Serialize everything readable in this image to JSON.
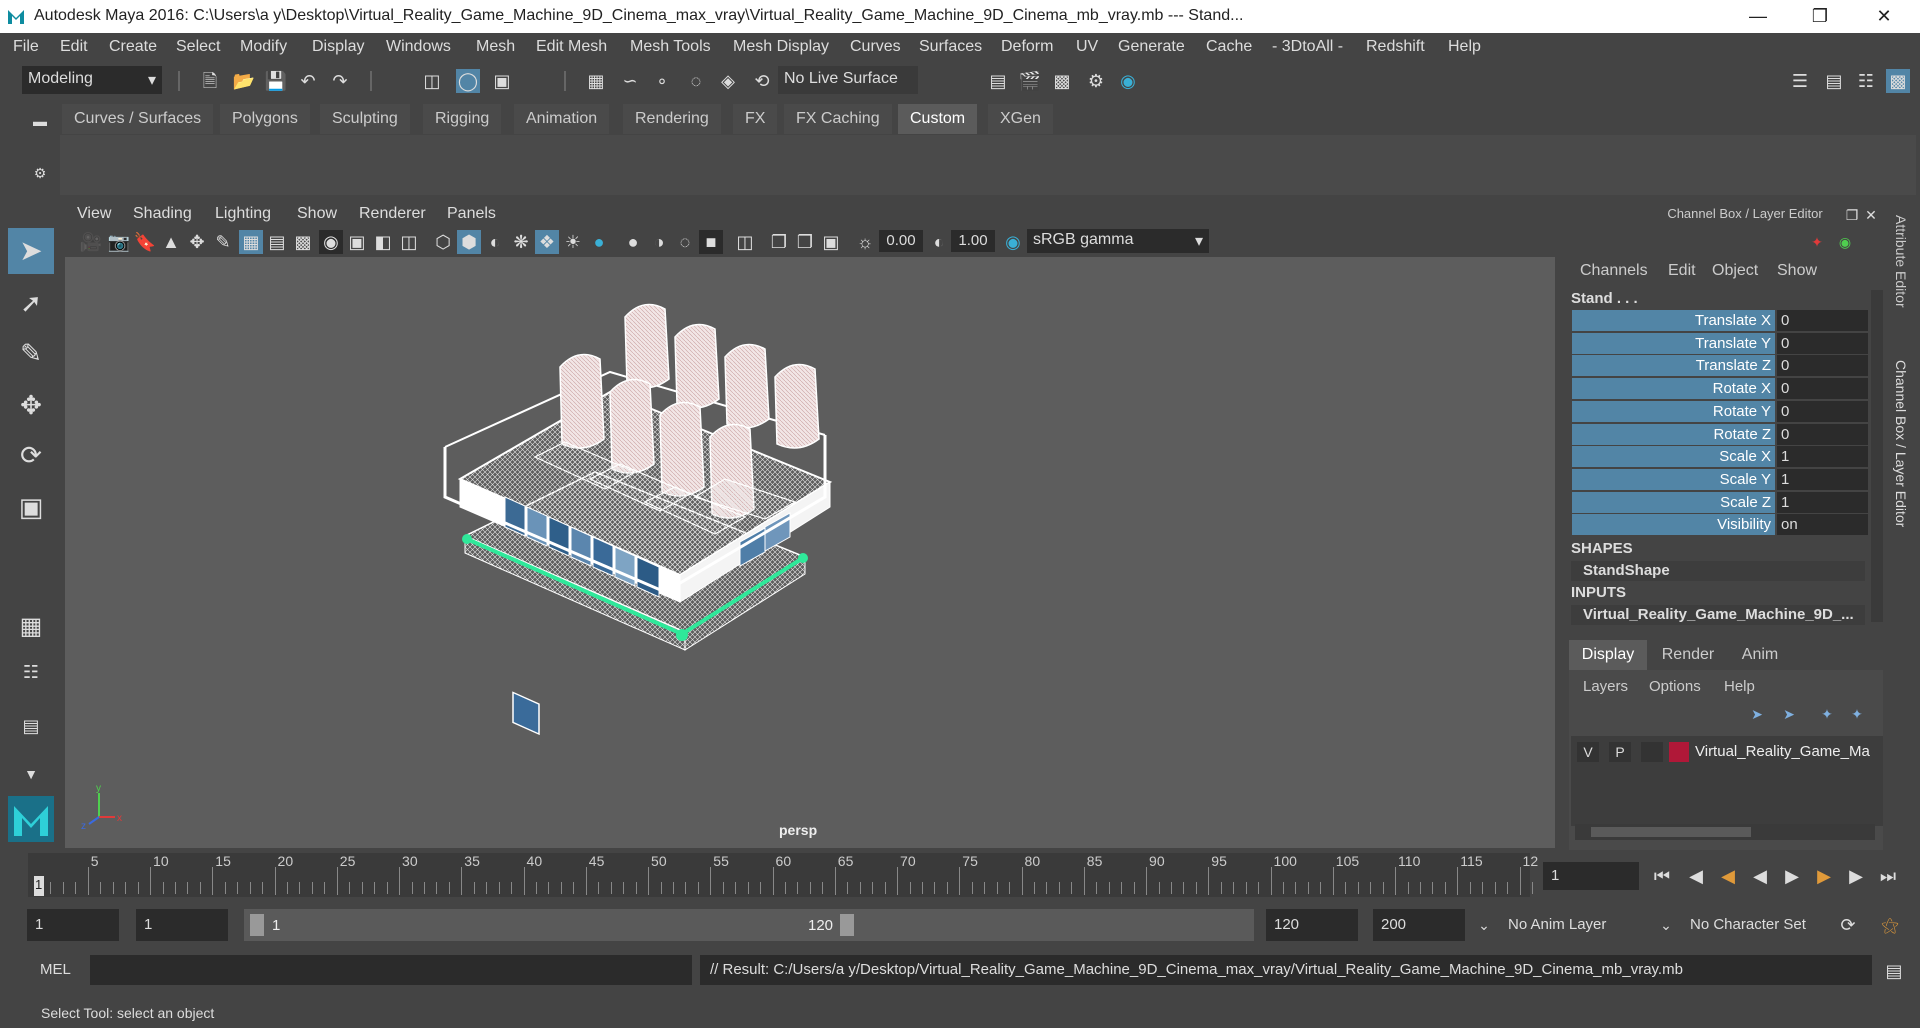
{
  "window": {
    "title": "Autodesk Maya 2016: C:\\Users\\a y\\Desktop\\Virtual_Reality_Game_Machine_9D_Cinema_max_vray\\Virtual_Reality_Game_Machine_9D_Cinema_mb_vray.mb  ---  Stand..."
  },
  "menubar": [
    "File",
    "Edit",
    "Create",
    "Select",
    "Modify",
    "Display",
    "Windows",
    "Mesh",
    "Edit Mesh",
    "Mesh Tools",
    "Mesh Display",
    "Curves",
    "Surfaces",
    "Deform",
    "UV",
    "Generate",
    "Cache",
    "- 3DtoAll -",
    "Redshift",
    "Help"
  ],
  "statusline": {
    "mode": "Modeling",
    "live_surface": "No Live Surface"
  },
  "shelf": {
    "tabs": [
      "Curves / Surfaces",
      "Polygons",
      "Sculpting",
      "Rigging",
      "Animation",
      "Rendering",
      "FX",
      "FX Caching",
      "Custom",
      "XGen"
    ],
    "active_tab": "Custom"
  },
  "viewport": {
    "menu": [
      "View",
      "Shading",
      "Lighting",
      "Show",
      "Renderer",
      "Panels"
    ],
    "exposure": "0.00",
    "gamma": "1.00",
    "color_space": "sRGB gamma",
    "camera_label": "persp"
  },
  "channel_box": {
    "title": "Channel Box / Layer Editor",
    "menu": [
      "Channels",
      "Edit",
      "Object",
      "Show"
    ],
    "object_name": "Stand . . .",
    "attributes": [
      {
        "label": "Translate X",
        "value": "0"
      },
      {
        "label": "Translate Y",
        "value": "0"
      },
      {
        "label": "Translate Z",
        "value": "0"
      },
      {
        "label": "Rotate X",
        "value": "0"
      },
      {
        "label": "Rotate Y",
        "value": "0"
      },
      {
        "label": "Rotate Z",
        "value": "0"
      },
      {
        "label": "Scale X",
        "value": "1"
      },
      {
        "label": "Scale Y",
        "value": "1"
      },
      {
        "label": "Scale Z",
        "value": "1"
      },
      {
        "label": "Visibility",
        "value": "on"
      }
    ],
    "shapes_header": "SHAPES",
    "shape_name": "StandShape",
    "inputs_header": "INPUTS",
    "input_name": "Virtual_Reality_Game_Machine_9D_...",
    "side_tabs": [
      "Attribute Editor",
      "Channel Box / Layer Editor"
    ]
  },
  "layer_editor": {
    "tabs": [
      "Display",
      "Render",
      "Anim"
    ],
    "active_tab": "Display",
    "menu": [
      "Layers",
      "Options",
      "Help"
    ],
    "layer": {
      "v": "V",
      "p": "P",
      "name": "Virtual_Reality_Game_Ma",
      "color": "#b01838"
    }
  },
  "timeline": {
    "ticks": [
      "5",
      "10",
      "15",
      "20",
      "25",
      "30",
      "35",
      "40",
      "45",
      "50",
      "55",
      "60",
      "65",
      "70",
      "75",
      "80",
      "85",
      "90",
      "95",
      "100",
      "105",
      "110",
      "115",
      "12"
    ],
    "current_frame_marker": "1",
    "current_frame": "1"
  },
  "range": {
    "start": "1",
    "playback_start": "1",
    "slider_start": "1",
    "slider_end": "120",
    "playback_end": "120",
    "end": "200",
    "anim_layer": "No Anim Layer",
    "character_set": "No Character Set"
  },
  "command_line": {
    "language": "MEL",
    "result": "// Result: C:/Users/a y/Desktop/Virtual_Reality_Game_Machine_9D_Cinema_max_vray/Virtual_Reality_Game_Machine_9D_Cinema_mb_vray.mb"
  },
  "help_line": "Select Tool: select an object",
  "colors": {
    "accent_blue": "#5285a6",
    "selection_green": "#2fe89a"
  }
}
